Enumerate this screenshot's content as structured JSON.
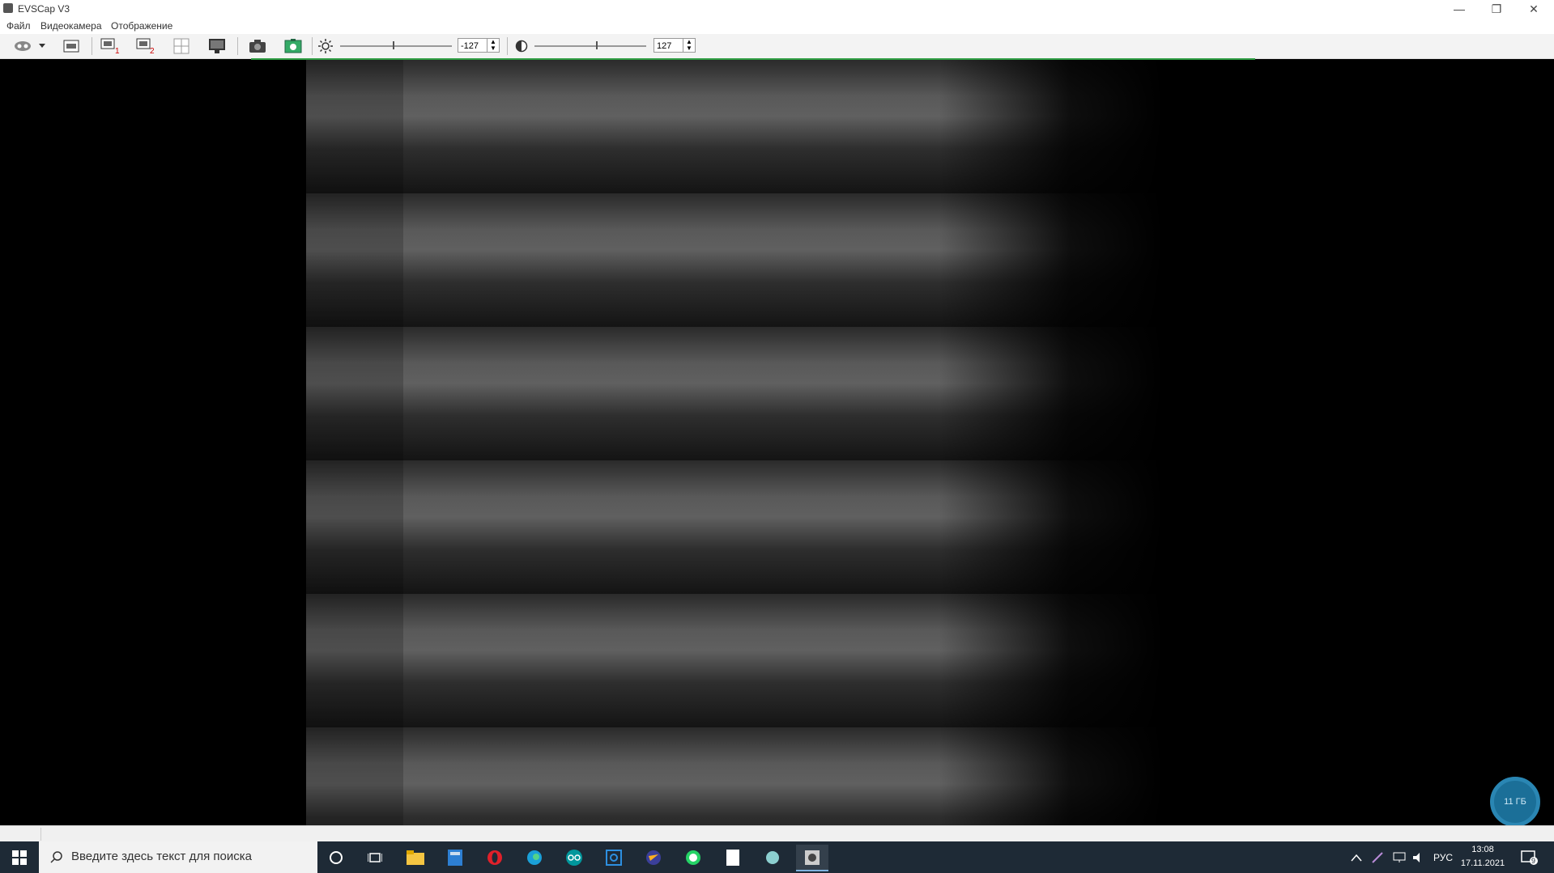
{
  "window": {
    "title": "EVSCap V3",
    "minimize": "—",
    "restore": "❐",
    "close": "✕"
  },
  "menu": [
    "Файл",
    "Видеокамера",
    "Отображение"
  ],
  "toolbar": {
    "brightness_value": "-127",
    "contrast_value": "127",
    "brightness_level": 0.47,
    "contrast_level": 0.55
  },
  "overlay": {
    "storage_badge": "11 ГБ"
  },
  "taskbar": {
    "search_placeholder": "Введите здесь текст для поиска",
    "tray_lang": "РУС",
    "time": "13:08",
    "date": "17.11.2021",
    "notifications_count": "9"
  },
  "colors": {
    "accent_green": "#2f9e44",
    "taskbar_bg": "#1e2a36",
    "badge_bg": "#1b6f98"
  }
}
